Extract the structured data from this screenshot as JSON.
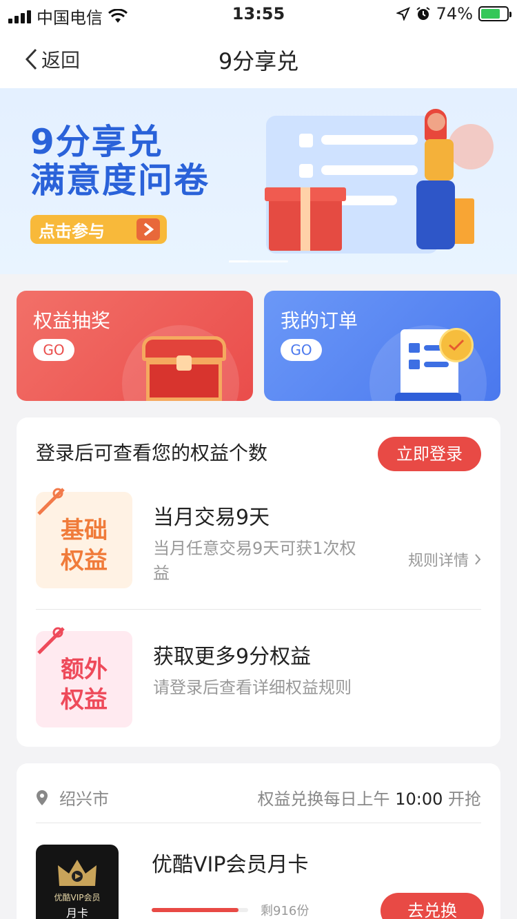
{
  "status_bar": {
    "carrier": "中国电信",
    "time": "13:55",
    "battery": "74%",
    "battery_level": 0.74
  },
  "nav": {
    "back_label": "返回",
    "title": "9分享兑"
  },
  "banner": {
    "title_line1": "9分享兑",
    "title_line2": "满意度问卷",
    "cta": "点击参与"
  },
  "entries": [
    {
      "label": "权益抽奖",
      "go": "GO"
    },
    {
      "label": "我的订单",
      "go": "GO"
    }
  ],
  "rights": {
    "title": "登录后可查看您的权益个数",
    "login_button": "立即登录",
    "items": [
      {
        "thumb_line1": "基础",
        "thumb_line2": "权益",
        "name": "当月交易9天",
        "desc": "当月任意交易9天可获1次权益",
        "rule": "规则详情"
      },
      {
        "thumb_line1": "额外",
        "thumb_line2": "权益",
        "name": "获取更多9分权益",
        "desc": "请登录后查看详细权益规则"
      }
    ]
  },
  "exchange": {
    "city": "绍兴市",
    "schedule_prefix": "权益兑换每日上午",
    "schedule_time": "10:00",
    "schedule_suffix": "开抢",
    "product": {
      "image_caption1": "优酷VIP会员",
      "image_caption2": "月卡",
      "name": "优酷VIP会员月卡",
      "remaining": "剩916份",
      "progress": 0.9,
      "button": "去兑换"
    }
  }
}
